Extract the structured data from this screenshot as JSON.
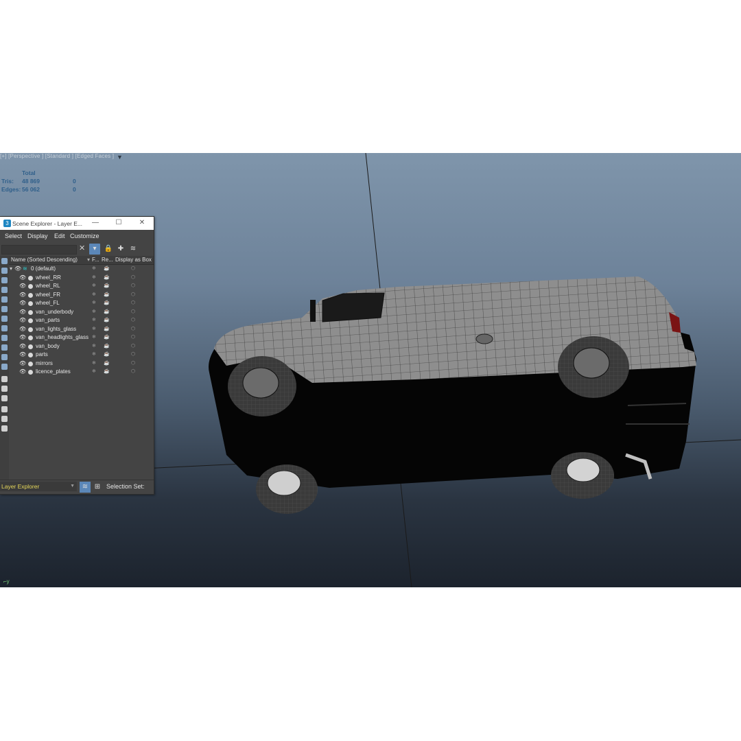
{
  "viewport": {
    "label": "[+] [Perspective ] [Standard ] [Edged Faces ]",
    "filter_icon": "funnel-icon",
    "stats": {
      "header": "Total",
      "tris_label": "Tris:",
      "tris_total": "48 869",
      "tris_sel": "0",
      "edges_label": "Edges:",
      "edges_total": "56 062",
      "edges_sel": "0"
    },
    "axis_label": "y"
  },
  "explorer": {
    "title": "Scene Explorer - Layer E...",
    "window_buttons": {
      "minimize": "—",
      "maximize": "☐",
      "close": "✕"
    },
    "menu": [
      "Select",
      "Display",
      "Edit",
      "Customize"
    ],
    "columns": {
      "name": "Name (Sorted Descending)",
      "freeze": "F...",
      "render": "Re...",
      "box": "Display as Box"
    },
    "root_layer": "0 (default)",
    "layers": [
      "wheel_RR",
      "wheel_RL",
      "wheel_FR",
      "wheel_FL",
      "van_underbody",
      "van_parts",
      "van_lights_glass",
      "van_headlights_glass",
      "van_body",
      "parts",
      "mirrors",
      "licence_plates"
    ],
    "footer": {
      "dropdown": "Layer Explorer",
      "selection_set": "Selection Set:"
    }
  },
  "colors": {
    "accent": "#5b87b8",
    "stats": "#2f5f8a",
    "dropdown_text": "#e6d75a"
  }
}
